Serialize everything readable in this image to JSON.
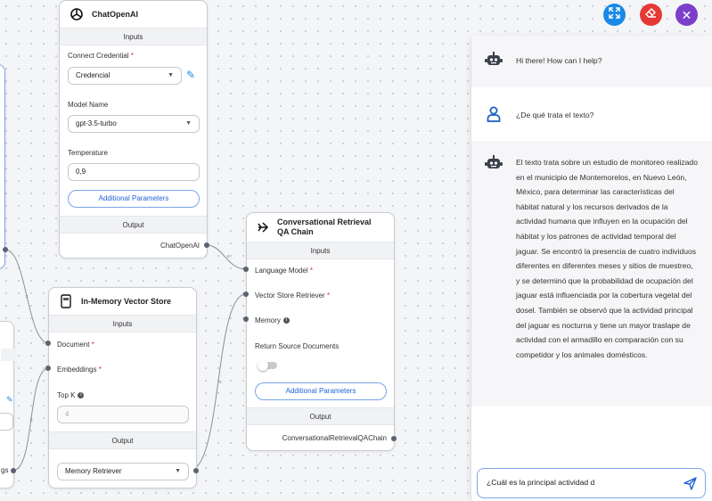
{
  "toolbar": {
    "expand_icon": "expand-arrows-icon",
    "clear_icon": "eraser-icon",
    "close_icon": "close-icon",
    "colors": {
      "expand": "#1a88e6",
      "clear": "#e53935",
      "close": "#7b3fc9"
    }
  },
  "nodes": {
    "chatopenai": {
      "title": "ChatOpenAI",
      "inputs_label": "Inputs",
      "credential_label": "Connect Credential",
      "credential_value": "Credencial",
      "model_label": "Model Name",
      "model_value": "gpt-3.5-turbo",
      "temperature_label": "Temperature",
      "temperature_value": "0,9",
      "additional_params": "Additional Parameters",
      "output_label": "Output",
      "output_name": "ChatOpenAI"
    },
    "vector_store": {
      "title": "In-Memory Vector Store",
      "inputs_label": "Inputs",
      "document_label": "Document",
      "embeddings_label": "Embeddings",
      "topk_label": "Top K",
      "topk_placeholder": "4",
      "output_label": "Output",
      "output_value": "Memory Retriever"
    },
    "qa_chain": {
      "title": "Conversational Retrieval QA Chain",
      "inputs_label": "Inputs",
      "language_model_label": "Language Model",
      "retriever_label": "Vector Store Retriever",
      "memory_label": "Memory",
      "return_docs_label": "Return Source Documents",
      "additional_params": "Additional Parameters",
      "output_label": "Output",
      "output_name": "ConversationalRetrievalQAChain"
    },
    "left_partial": {
      "edge_text": "gs"
    }
  },
  "chat": {
    "messages": [
      {
        "role": "bot",
        "icon": "robot-icon",
        "text": "Hi there! How can I help?"
      },
      {
        "role": "user",
        "icon": "user-icon",
        "text": "¿De qué trata el texto?"
      },
      {
        "role": "bot",
        "icon": "robot-icon",
        "text": "El texto trata sobre un estudio de monitoreo realizado en el municipio de Montemorelos, en Nuevo León, México, para determinar las características del hábitat natural y los recursos derivados de la actividad humana que influyen en la ocupación del hábitat y los patrones de actividad temporal del jaguar. Se encontró la presencia de cuatro individuos diferentes en diferentes meses y sitios de muestreo, y se determinó que la probabilidad de ocupación del jaguar está influenciada por la cobertura vegetal del dosel. También se observó que la actividad principal del jaguar es nocturna y tiene un mayor traslape de actividad con el armadillo en comparación con su competidor y los animales domésticos."
      }
    ],
    "input_value": "¿Cuál es la principal actividad d",
    "send_icon": "send-icon"
  }
}
